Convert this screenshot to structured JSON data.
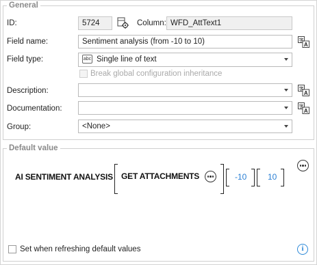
{
  "general": {
    "legend": "General",
    "id_label": "ID:",
    "id_value": "5724",
    "column_label": "Column:",
    "column_value": "WFD_AttText1",
    "field_name_label": "Field name:",
    "field_name_value": "Sentiment analysis (from -10 to 10)",
    "field_type_label": "Field type:",
    "field_type_value": "Single line of text",
    "field_type_icon_text": "abc",
    "break_inheritance_label": "Break global configuration inheritance",
    "description_label": "Description:",
    "description_value": "",
    "documentation_label": "Documentation:",
    "documentation_value": "",
    "group_label": "Group:",
    "group_value": "<None>"
  },
  "default_value": {
    "legend": "Default value",
    "expression": {
      "function1": "AI SENTIMENT ANALYSIS",
      "function2": "GET ATTACHMENTS",
      "arg1": "-10",
      "arg2": "10"
    },
    "refresh_label": "Set when refreshing default values"
  },
  "icons": {
    "column_settings": "gear-table-icon",
    "translate": "translate-icon",
    "more": "more-icon",
    "info": "info-icon"
  },
  "colors": {
    "accent_blue": "#2a7fd4",
    "legend_gray": "#8a8a8a"
  }
}
